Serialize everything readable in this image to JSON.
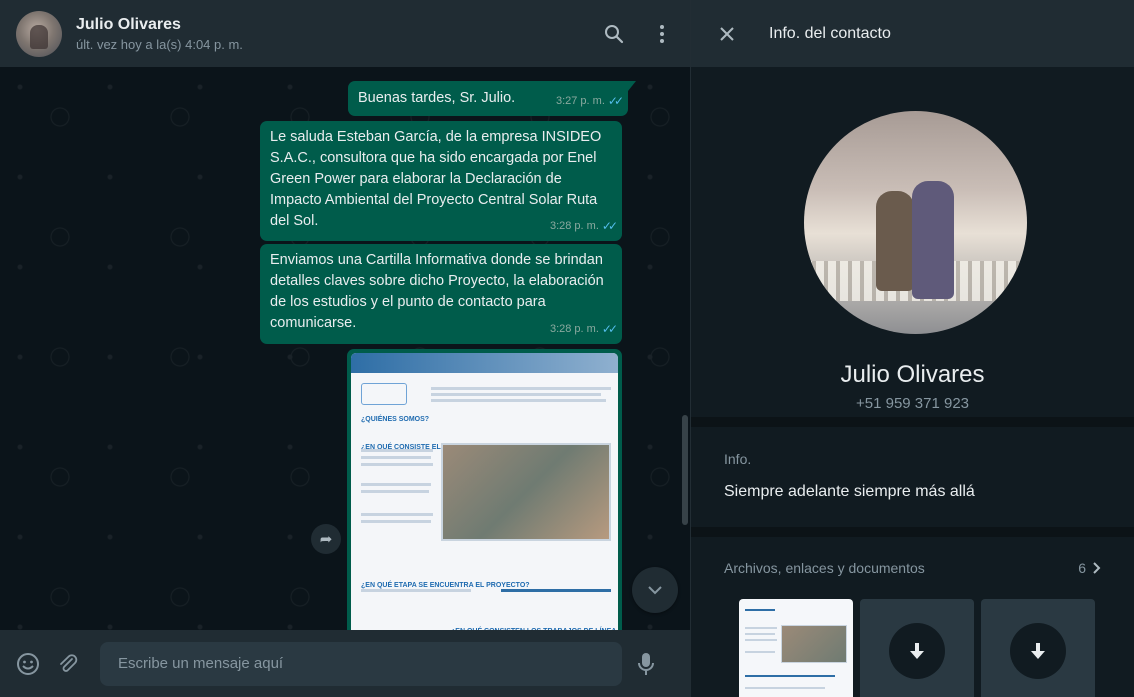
{
  "chat": {
    "contact_name": "Julio Olivares",
    "last_seen": "últ. vez hoy a la(s) 4:04 p. m.",
    "messages": [
      {
        "text": "Buenas tardes, Sr. Julio.",
        "time": "3:27 p. m."
      },
      {
        "text": "Le saluda Esteban García, de la empresa INSIDEO S.A.C., consultora que ha sido encargada por Enel Green Power para elaborar la Declaración de Impacto Ambiental del Proyecto Central Solar Ruta del Sol.",
        "time": "3:28 p. m."
      },
      {
        "text": "Enviamos una Cartilla Informativa donde se brindan detalles claves sobre dicho Proyecto, la elaboración de los estudios y el punto de contacto para comunicarse.",
        "time": "3:28 p. m."
      }
    ],
    "document_preview": {
      "headings": [
        "¿QUIÉNES SOMOS?",
        "¿EN QUÉ CONSISTE EL PROYECTO?",
        "¿EN QUÉ ETAPA SE ENCUENTRA EL PROYECTO?",
        "¿EN QUÉ CONSISTEN LOS TRABAJOS DE LÍNEA BASE?"
      ]
    },
    "composer_placeholder": "Escribe un mensaje aquí"
  },
  "info": {
    "title": "Info. del contacto",
    "name": "Julio Olivares",
    "phone": "+51 959 371 923",
    "about_label": "Info.",
    "about_text": "Siempre adelante siempre más allá",
    "files_label": "Archivos, enlaces y documentos",
    "files_count": "6"
  },
  "colors": {
    "bubble_out": "#005c4b",
    "panel": "#202c33",
    "background": "#0b141a",
    "read_ticks": "#53bdeb"
  },
  "icons": [
    "search-icon",
    "menu-icon",
    "close-icon",
    "forward-icon",
    "chevron-down-icon",
    "emoji-icon",
    "attach-icon",
    "microphone-icon",
    "chevron-right-icon",
    "download-icon"
  ]
}
